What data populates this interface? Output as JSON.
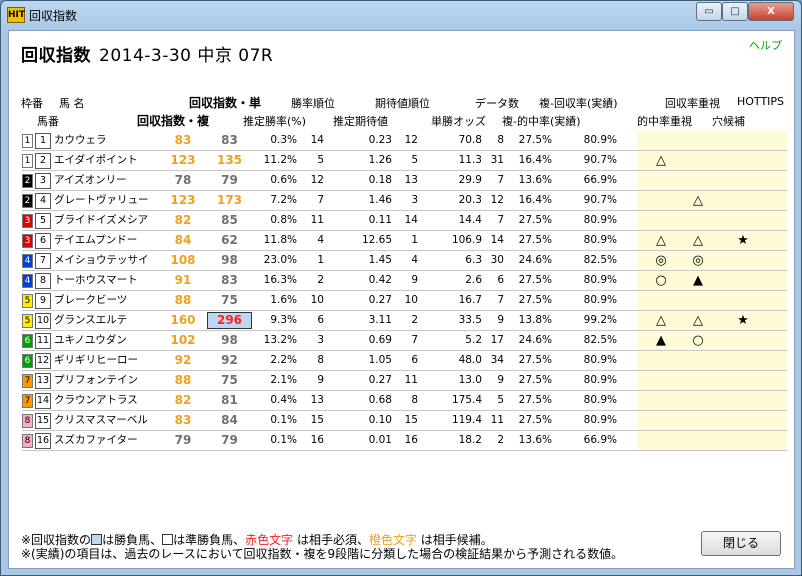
{
  "window": {
    "title": "回収指数",
    "icon_text": "HIT"
  },
  "controls": {
    "minimize": "▭",
    "maximize": "□",
    "close": "X"
  },
  "help": "ヘルプ",
  "heading": {
    "main": "回収指数",
    "sub": "2014-3-30 中京 07R"
  },
  "headers_top": {
    "waku": "枠番",
    "name": "馬 名",
    "index_single": "回収指数・単",
    "win_rank": "勝率順位",
    "exp_rank": "期待値順位",
    "data_count": "データ数",
    "place_rate": "複-回収率(実績)",
    "focus_return": "回収率重視",
    "hottips": "HOTTIPS"
  },
  "headers_bottom": {
    "uma": "馬番",
    "index_place": "回収指数・複",
    "est_win": "推定勝率(%)",
    "est_exp": "推定期待値",
    "odds": "単勝オッズ",
    "hit_rate": "複-的中率(実績)",
    "focus_hit": "的中率重視",
    "longshot": "穴候補"
  },
  "colors": {
    "orange": "#f0a020",
    "red": "#ff2020",
    "highlight": "#fffbd6"
  },
  "rows": [
    {
      "waku": "1",
      "wbg": "#ffffff",
      "wfg": "#000",
      "uma": "1",
      "name": "カウウェラ",
      "s1": "83",
      "s1c": "orange",
      "s2": "83",
      "s2c": "gray",
      "box": false,
      "c1": "0.3%",
      "c2": "14",
      "c3": "0.23",
      "c4": "12",
      "c5": "70.8",
      "c6": "8",
      "c7": "27.5%",
      "c8": "80.9%",
      "m1": "",
      "m2": "",
      "m3": ""
    },
    {
      "waku": "1",
      "wbg": "#ffffff",
      "wfg": "#000",
      "uma": "2",
      "name": "エイダイポイント",
      "s1": "123",
      "s1c": "orange",
      "s2": "135",
      "s2c": "orange",
      "box": false,
      "c1": "11.2%",
      "c2": "5",
      "c3": "1.26",
      "c4": "5",
      "c5": "11.3",
      "c6": "31",
      "c7": "16.4%",
      "c8": "90.7%",
      "m1": "△",
      "m2": "",
      "m3": ""
    },
    {
      "waku": "2",
      "wbg": "#000000",
      "wfg": "#fff",
      "uma": "3",
      "name": "アイズオンリー",
      "s1": "78",
      "s1c": "gray",
      "s2": "79",
      "s2c": "gray",
      "box": false,
      "c1": "0.6%",
      "c2": "12",
      "c3": "0.18",
      "c4": "13",
      "c5": "29.9",
      "c6": "7",
      "c7": "13.6%",
      "c8": "66.9%",
      "m1": "",
      "m2": "",
      "m3": ""
    },
    {
      "waku": "2",
      "wbg": "#000000",
      "wfg": "#fff",
      "uma": "4",
      "name": "グレートヴァリュー",
      "s1": "123",
      "s1c": "orange",
      "s2": "173",
      "s2c": "orange",
      "box": false,
      "c1": "7.2%",
      "c2": "7",
      "c3": "1.46",
      "c4": "3",
      "c5": "20.3",
      "c6": "12",
      "c7": "16.4%",
      "c8": "90.7%",
      "m1": "",
      "m2": "△",
      "m3": ""
    },
    {
      "waku": "3",
      "wbg": "#e00000",
      "wfg": "#fff",
      "uma": "5",
      "name": "ブライドイズメシア",
      "s1": "82",
      "s1c": "orange",
      "s2": "85",
      "s2c": "gray",
      "box": false,
      "c1": "0.8%",
      "c2": "11",
      "c3": "0.11",
      "c4": "14",
      "c5": "14.4",
      "c6": "7",
      "c7": "27.5%",
      "c8": "80.9%",
      "m1": "",
      "m2": "",
      "m3": ""
    },
    {
      "waku": "3",
      "wbg": "#e00000",
      "wfg": "#fff",
      "uma": "6",
      "name": "テイエムプンドー",
      "s1": "84",
      "s1c": "orange",
      "s2": "62",
      "s2c": "gray",
      "box": false,
      "c1": "11.8%",
      "c2": "4",
      "c3": "12.65",
      "c4": "1",
      "c5": "106.9",
      "c6": "14",
      "c7": "27.5%",
      "c8": "80.9%",
      "m1": "△",
      "m2": "△",
      "m3": "★"
    },
    {
      "waku": "4",
      "wbg": "#0040e0",
      "wfg": "#fff",
      "uma": "7",
      "name": "メイショウテッサイ",
      "s1": "108",
      "s1c": "orange",
      "s2": "98",
      "s2c": "gray",
      "box": false,
      "c1": "23.0%",
      "c2": "1",
      "c3": "1.45",
      "c4": "4",
      "c5": "6.3",
      "c6": "30",
      "c7": "24.6%",
      "c8": "82.5%",
      "m1": "◎",
      "m2": "◎",
      "m3": ""
    },
    {
      "waku": "4",
      "wbg": "#0040e0",
      "wfg": "#fff",
      "uma": "8",
      "name": "トーホウスマート",
      "s1": "91",
      "s1c": "orange",
      "s2": "83",
      "s2c": "gray",
      "box": false,
      "c1": "16.3%",
      "c2": "2",
      "c3": "0.42",
      "c4": "9",
      "c5": "2.6",
      "c6": "6",
      "c7": "27.5%",
      "c8": "80.9%",
      "m1": "○",
      "m2": "▲",
      "m3": ""
    },
    {
      "waku": "5",
      "wbg": "#ffee00",
      "wfg": "#000",
      "uma": "9",
      "name": "ブレークビーツ",
      "s1": "88",
      "s1c": "orange",
      "s2": "75",
      "s2c": "gray",
      "box": false,
      "c1": "1.6%",
      "c2": "10",
      "c3": "0.27",
      "c4": "10",
      "c5": "16.7",
      "c6": "7",
      "c7": "27.5%",
      "c8": "80.9%",
      "m1": "",
      "m2": "",
      "m3": ""
    },
    {
      "waku": "5",
      "wbg": "#ffee00",
      "wfg": "#000",
      "uma": "10",
      "name": "グランスエルテ",
      "s1": "160",
      "s1c": "orange",
      "s2": "296",
      "s2c": "red",
      "box": true,
      "c1": "9.3%",
      "c2": "6",
      "c3": "3.11",
      "c4": "2",
      "c5": "33.5",
      "c6": "9",
      "c7": "13.8%",
      "c8": "99.2%",
      "m1": "△",
      "m2": "△",
      "m3": "★"
    },
    {
      "waku": "6",
      "wbg": "#00a000",
      "wfg": "#fff",
      "uma": "11",
      "name": "ユキノユウダン",
      "s1": "102",
      "s1c": "orange",
      "s2": "98",
      "s2c": "gray",
      "box": false,
      "c1": "13.2%",
      "c2": "3",
      "c3": "0.69",
      "c4": "7",
      "c5": "5.2",
      "c6": "17",
      "c7": "24.6%",
      "c8": "82.5%",
      "m1": "▲",
      "m2": "○",
      "m3": ""
    },
    {
      "waku": "6",
      "wbg": "#00a000",
      "wfg": "#fff",
      "uma": "12",
      "name": "ギリギリヒーロー",
      "s1": "92",
      "s1c": "orange",
      "s2": "92",
      "s2c": "gray",
      "box": false,
      "c1": "2.2%",
      "c2": "8",
      "c3": "1.05",
      "c4": "6",
      "c5": "48.0",
      "c6": "34",
      "c7": "27.5%",
      "c8": "80.9%",
      "m1": "",
      "m2": "",
      "m3": ""
    },
    {
      "waku": "7",
      "wbg": "#ff9900",
      "wfg": "#000",
      "uma": "13",
      "name": "プリフォンテイン",
      "s1": "88",
      "s1c": "orange",
      "s2": "75",
      "s2c": "gray",
      "box": false,
      "c1": "2.1%",
      "c2": "9",
      "c3": "0.27",
      "c4": "11",
      "c5": "13.0",
      "c6": "9",
      "c7": "27.5%",
      "c8": "80.9%",
      "m1": "",
      "m2": "",
      "m3": ""
    },
    {
      "waku": "7",
      "wbg": "#ff9900",
      "wfg": "#000",
      "uma": "14",
      "name": "クラウンアトラス",
      "s1": "82",
      "s1c": "orange",
      "s2": "81",
      "s2c": "gray",
      "box": false,
      "c1": "0.4%",
      "c2": "13",
      "c3": "0.68",
      "c4": "8",
      "c5": "175.4",
      "c6": "5",
      "c7": "27.5%",
      "c8": "80.9%",
      "m1": "",
      "m2": "",
      "m3": ""
    },
    {
      "waku": "8",
      "wbg": "#ffaac8",
      "wfg": "#000",
      "uma": "15",
      "name": "クリスマスマーベル",
      "s1": "83",
      "s1c": "orange",
      "s2": "84",
      "s2c": "gray",
      "box": false,
      "c1": "0.1%",
      "c2": "15",
      "c3": "0.10",
      "c4": "15",
      "c5": "119.4",
      "c6": "11",
      "c7": "27.5%",
      "c8": "80.9%",
      "m1": "",
      "m2": "",
      "m3": ""
    },
    {
      "waku": "8",
      "wbg": "#ffaac8",
      "wfg": "#000",
      "uma": "16",
      "name": "スズカファイター",
      "s1": "79",
      "s1c": "gray",
      "s2": "79",
      "s2c": "gray",
      "box": false,
      "c1": "0.1%",
      "c2": "16",
      "c3": "0.01",
      "c4": "16",
      "c5": "18.2",
      "c6": "2",
      "c7": "13.6%",
      "c8": "66.9%",
      "m1": "",
      "m2": "",
      "m3": ""
    }
  ],
  "notes": {
    "line1_a": "※回収指数の",
    "line1_b": "は勝負馬、",
    "line1_c": "は準勝負馬、",
    "line1_red": "赤色文字",
    "line1_d": "は相手必須、",
    "line1_orange": "橙色文字",
    "line1_e": "は相手候補。",
    "line2": "※(実績)の項目は、過去のレースにおいて回収指数・複を9段階に分類した場合の検証結果から予測される数値。"
  },
  "close_button": "閉じる"
}
